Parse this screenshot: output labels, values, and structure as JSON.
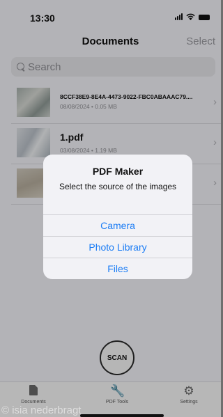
{
  "status_bar": {
    "time": "13:30"
  },
  "nav": {
    "title": "Documents",
    "select_label": "Select"
  },
  "search": {
    "placeholder": "Search"
  },
  "documents": [
    {
      "title": "8CCF38E9-8E4A-4473-9022-FBC0ABAAAC79....",
      "meta": "08/08/2024 • 0.05 MB"
    },
    {
      "title": "1.pdf",
      "meta": "03/08/2024 • 1.19 MB"
    },
    {
      "title": "",
      "meta": ""
    }
  ],
  "alert": {
    "title": "PDF Maker",
    "message": "Select the source of the images",
    "actions": [
      "Camera",
      "Photo Library",
      "Files"
    ]
  },
  "scan_button": {
    "label": "SCAN"
  },
  "tabs": [
    {
      "label": "Documents",
      "icon": "document-icon"
    },
    {
      "label": "PDF Tools",
      "icon": "wrench-icon"
    },
    {
      "label": "Settings",
      "icon": "gear-icon"
    }
  ],
  "watermark": "© isia nederbragt",
  "colors": {
    "accent": "#1a7cf5"
  }
}
